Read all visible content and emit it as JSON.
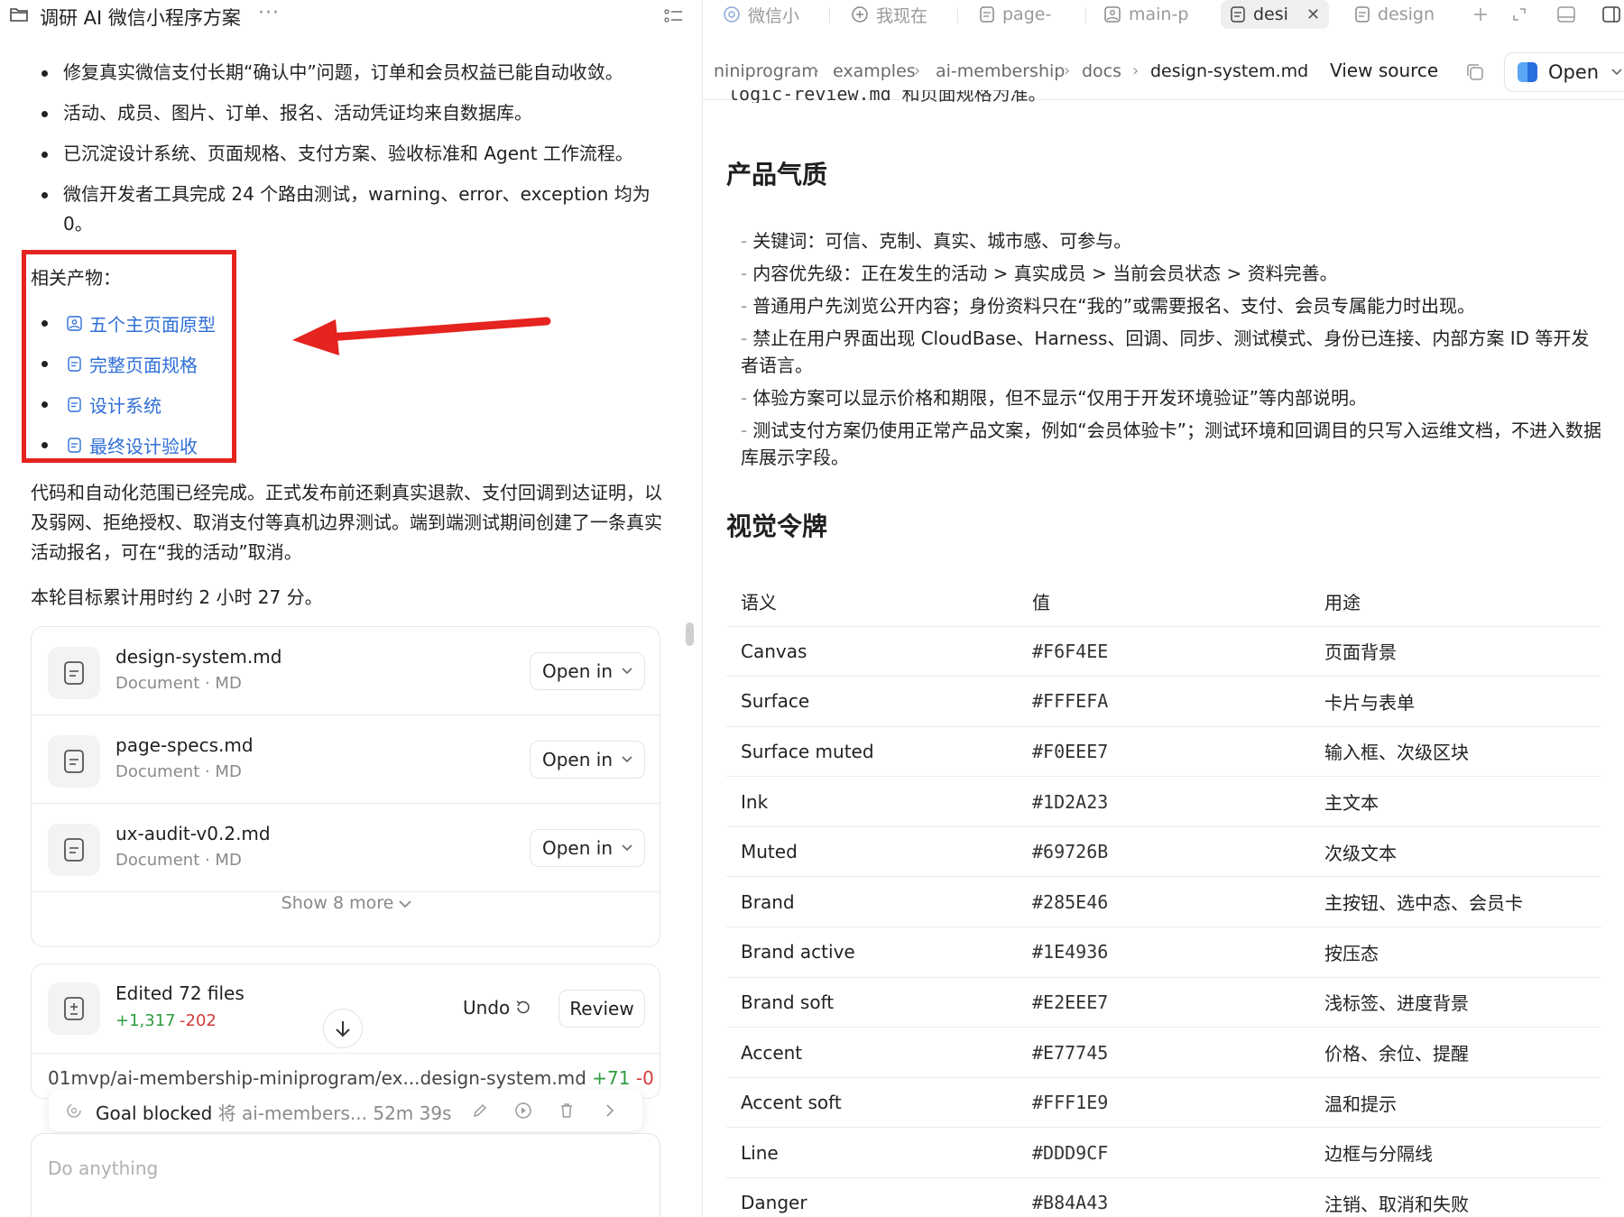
{
  "left": {
    "header": {
      "title": "调研 AI 微信小程序方案",
      "more": "···"
    },
    "bullets": [
      "修复真实微信支付长期“确认中”问题，订单和会员权益已能自动收敛。",
      "活动、成员、图片、订单、报名、活动凭证均来自数据库。",
      "已沉淀设计系统、页面规格、支付方案、验收标准和 Agent 工作流程。",
      "微信开发者工具完成 24 个路由测试，warning、error、exception 均为 0。"
    ],
    "related": {
      "title": "相关产物：",
      "links": [
        "五个主页面原型",
        "完整页面规格",
        "设计系统",
        "最终设计验收"
      ]
    },
    "paragraph1": "代码和自动化范围已经完成。正式发布前还剩真实退款、支付回调到达证明，以及弱网、拒绝授权、取消支付等真机边界测试。端到端测试期间创建了一条真实活动报名，可在“我的活动”取消。",
    "paragraph2": "本轮目标累计用时约 2 小时 27 分。",
    "files": [
      {
        "name": "design-system.md",
        "sub": "Document · MD",
        "action": "Open in"
      },
      {
        "name": "page-specs.md",
        "sub": "Document · MD",
        "action": "Open in"
      },
      {
        "name": "ux-audit-v0.2.md",
        "sub": "Document · MD",
        "action": "Open in"
      }
    ],
    "show_more": "Show 8 more",
    "edits": {
      "title": "Edited 72 files",
      "added": "+1,317",
      "removed": "-202",
      "undo": "Undo",
      "review": "Review",
      "path": "01mvp/ai-membership-miniprogram/ex...",
      "path_file": "design-system.md",
      "path_added": "+71",
      "path_removed": "-0"
    },
    "goal": {
      "label": "Goal blocked",
      "sub": "将 ai-members...",
      "time": "52m 39s"
    },
    "input": {
      "placeholder": "Do anything"
    }
  },
  "right": {
    "tabs": [
      {
        "label": "微信小",
        "icon": "globe-icon"
      },
      {
        "label": "我现在",
        "icon": "add-circle-icon"
      },
      {
        "label": "page-",
        "icon": "document-icon"
      },
      {
        "label": "main-p",
        "icon": "image-icon"
      },
      {
        "label": "desi",
        "icon": "document-icon",
        "active": true
      },
      {
        "label": "design",
        "icon": "document-icon"
      }
    ],
    "breadcrumb": [
      "niniprogram",
      "examples",
      "ai-membership",
      "docs",
      "design-system.md"
    ],
    "view_source": "View source",
    "open_label": "Open",
    "doc": {
      "cut_line": "logic-review.md 和页面规格为准。",
      "section1_title": "产品气质",
      "section1_lines": [
        "关键词：可信、克制、真实、城市感、可参与。",
        "内容优先级：正在发生的活动 > 真实成员 > 当前会员状态 > 资料完善。",
        "普通用户先浏览公开内容；身份资料只在“我的”或需要报名、支付、会员专属能力时出现。",
        "禁止在用户界面出现 CloudBase、Harness、回调、同步、测试模式、身份已连接、内部方案 ID 等开发者语言。",
        "体验方案可以显示价格和期限，但不显示“仅用于开发环境验证”等内部说明。",
        "测试支付方案仍使用正常产品文案，例如“会员体验卡”；测试环境和回调目的只写入运维文档，不进入数据库展示字段。"
      ],
      "section2_title": "视觉令牌",
      "table_headers": [
        "语义",
        "值",
        "用途"
      ],
      "tokens": [
        [
          "Canvas",
          "#F6F4EE",
          "页面背景"
        ],
        [
          "Surface",
          "#FFFEFA",
          "卡片与表单"
        ],
        [
          "Surface muted",
          "#F0EEE7",
          "输入框、次级区块"
        ],
        [
          "Ink",
          "#1D2A23",
          "主文本"
        ],
        [
          "Muted",
          "#69726B",
          "次级文本"
        ],
        [
          "Brand",
          "#285E46",
          "主按钮、选中态、会员卡"
        ],
        [
          "Brand active",
          "#1E4936",
          "按压态"
        ],
        [
          "Brand soft",
          "#E2EEE7",
          "浅标签、进度背景"
        ],
        [
          "Accent",
          "#E77745",
          "价格、余位、提醒"
        ],
        [
          "Accent soft",
          "#FFF1E9",
          "温和提示"
        ],
        [
          "Line",
          "#DDD9CF",
          "边框与分隔线"
        ],
        [
          "Danger",
          "#B84A43",
          "注销、取消和失败"
        ]
      ]
    }
  },
  "colors": {
    "link": "#2f6fd6",
    "highlight": "#e5231f",
    "added": "#2e9d3f",
    "removed": "#d23a3a"
  }
}
